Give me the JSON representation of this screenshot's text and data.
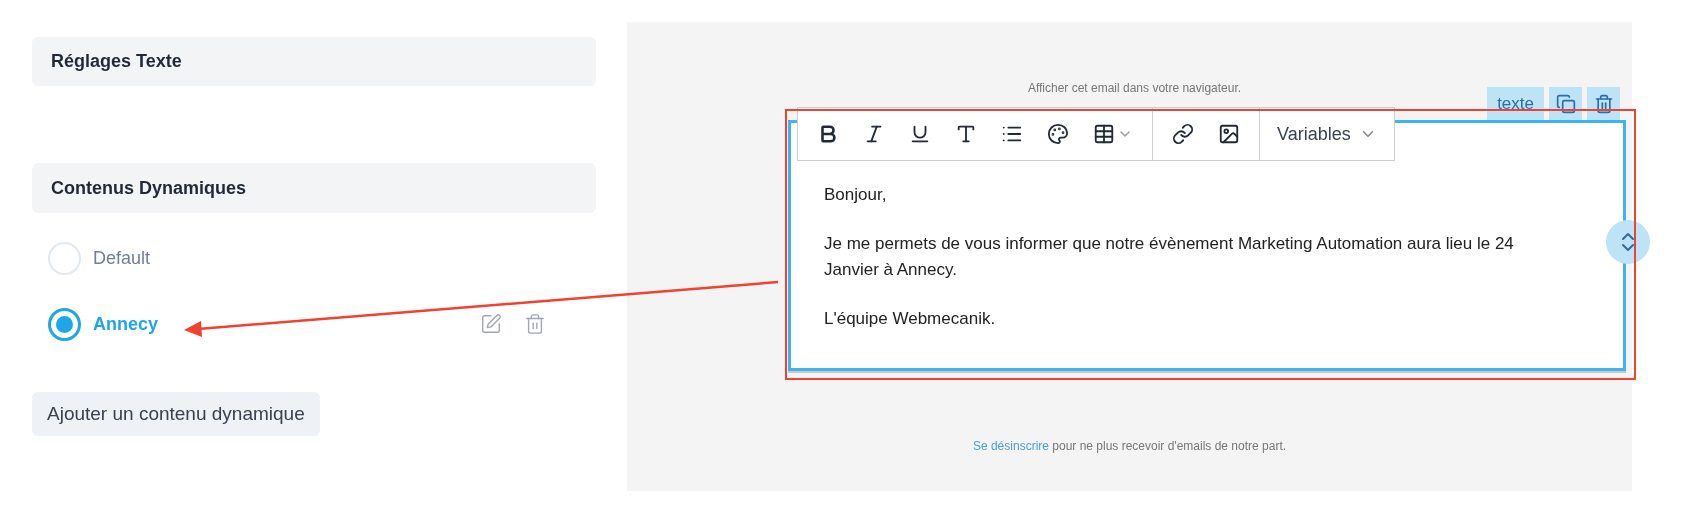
{
  "settings_panel": {
    "title": "Réglages Texte"
  },
  "dynamic_content": {
    "title": "Contenus Dynamiques",
    "items": [
      {
        "label": "Default",
        "selected": false
      },
      {
        "label": "Annecy",
        "selected": true
      }
    ],
    "add_button": "Ajouter un contenu dynamique"
  },
  "email_preview": {
    "browser_link": "Afficher cet email dans votre navigateur.",
    "block_tag": "texte",
    "toolbar": [
      {
        "kind": "bold"
      },
      {
        "kind": "italic"
      },
      {
        "kind": "underline"
      },
      {
        "kind": "text"
      },
      {
        "kind": "list"
      },
      {
        "kind": "palette"
      },
      {
        "kind": "table"
      },
      {
        "kind": "link"
      },
      {
        "kind": "image"
      }
    ],
    "variables_menu": "Variables",
    "paragraphs": [
      "Bonjour,",
      "Je me permets de vous informer que notre évènement Marketing Automation aura lieu le 24 Janvier à Annecy.",
      "L'équipe Webmecanik."
    ],
    "unsubscribe_link": "Se désinscrire",
    "footer_text": " pour ne plus recevoir d'emails de notre part."
  }
}
